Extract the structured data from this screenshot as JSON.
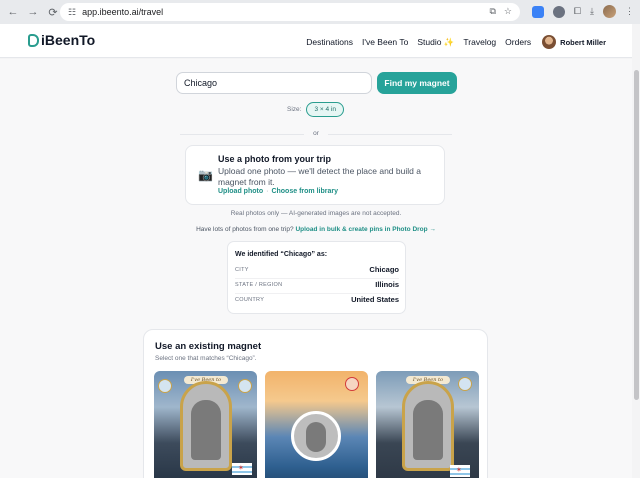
{
  "browser": {
    "url": "app.ibeento.ai/travel"
  },
  "header": {
    "logo_text": "iBeenTo",
    "nav": [
      "Destinations",
      "I've Been To",
      "Studio ✨",
      "Travelog",
      "Orders"
    ],
    "user_name": "Robert Miller"
  },
  "search": {
    "value": "Chicago",
    "button_label": "Find my magnet",
    "size_label": "Size:",
    "size_value": "3 × 4 in",
    "or_label": "or"
  },
  "photo_card": {
    "title": "Use a photo from your trip",
    "description": "Upload one photo — we'll detect the place and build a magnet from it.",
    "upload_link": "Upload photo",
    "separator": "·",
    "library_link": "Choose from library",
    "camera_icon": "📷"
  },
  "notes": {
    "real_photos": "Real photos only — AI-generated images are not accepted.",
    "bulk_prefix": "Have lots of photos from one trip?",
    "bulk_link": "Upload in bulk & create pins in Photo Drop →"
  },
  "identified": {
    "title": "We identified “Chicago” as:",
    "rows": [
      {
        "key": "CITY",
        "value": "Chicago"
      },
      {
        "key": "STATE / REGION",
        "value": "Illinois"
      },
      {
        "key": "COUNTRY",
        "value": "United States"
      }
    ]
  },
  "existing": {
    "title": "Use an existing magnet",
    "subtitle": "Select one that matches “Chicago”.",
    "magnet_banner": "I've Been to"
  },
  "colors": {
    "accent": "#27a39a",
    "link": "#1f8f86"
  }
}
